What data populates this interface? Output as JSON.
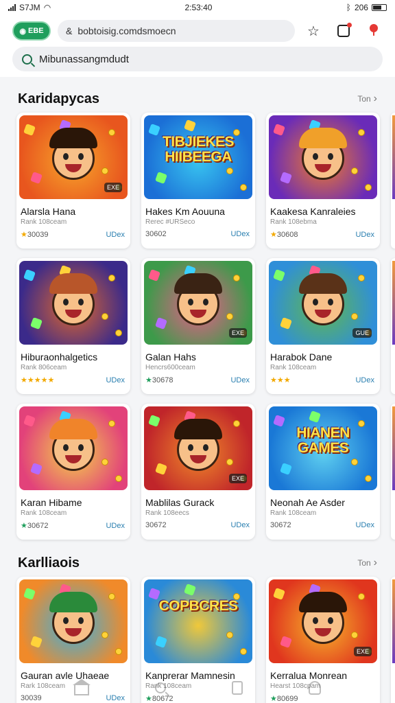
{
  "status_bar": {
    "carrier_time": "S7JM",
    "clock": "2:53:40",
    "battery": "206"
  },
  "browser": {
    "badge_label": "EBE",
    "url": "bobtoisig.comdsmoecn",
    "icons": [
      "star-icon",
      "tabs-icon",
      "notification-icon"
    ]
  },
  "search": {
    "value": "Mibunassangmdudt",
    "placeholder": "Mibunassangmdudt"
  },
  "sections": [
    {
      "title": "Karidapycas",
      "more": "Ton",
      "cards": [
        {
          "title": "Alarsla Hana",
          "sub": "Rank 108ceam",
          "rating": "30039",
          "star": "gold",
          "size": "UDex",
          "tag": "EXE",
          "bg": [
            "#e8561e",
            "#f7a52b"
          ],
          "hair": "#2a1608"
        },
        {
          "title": "Hakes Km Aouuna",
          "sub": "Rerec #URSeco",
          "rating": "30602",
          "star": "none",
          "size": "UDex",
          "banner": "TIBJIEKES HIIBEEGA",
          "bg": [
            "#1b6fd6",
            "#38c4f0"
          ],
          "hair": "#e66c1a"
        },
        {
          "title": "Kaakesa Kanraleies",
          "sub": "Rank 108ebma",
          "rating": "30608",
          "star": "gold",
          "size": "UDex",
          "bg": [
            "#6a2bb8",
            "#f07b2a"
          ],
          "hair": "#f0a02a"
        }
      ]
    },
    {
      "title": "",
      "more": "",
      "cards": [
        {
          "title": "Hiburaonhalgetics",
          "sub": "Rank 806ceam",
          "rating": "★★★★★",
          "star": "stars",
          "size": "UDex",
          "bg": [
            "#3b2a8a",
            "#e2682b"
          ],
          "hair": "#b8562a"
        },
        {
          "title": "Galan Hahs",
          "sub": "Hencrs600ceam",
          "rating": "30678",
          "star": "green",
          "size": "UDex",
          "tag": "EXE",
          "bg": [
            "#3d9a4a",
            "#e95d8a"
          ],
          "hair": "#3a2314"
        },
        {
          "title": "Harabok Dane",
          "sub": "Rank 108ceam",
          "rating": "★★★",
          "star": "stars",
          "size": "UDex",
          "tag": "GUE",
          "bg": [
            "#2f8fd8",
            "#62b84c"
          ],
          "hair": "#5a3218"
        }
      ]
    },
    {
      "title": "",
      "more": "",
      "cards": [
        {
          "title": "Karan Hibame",
          "sub": "Rank 108ceam",
          "rating": "30672",
          "star": "green",
          "size": "UDex",
          "bg": [
            "#e2427a",
            "#f4d14a"
          ],
          "hair": "#f0842a"
        },
        {
          "title": "Mablilas Gurack",
          "sub": "Rank 108eecs",
          "rating": "30672",
          "star": "none",
          "size": "UDex",
          "tag": "EXE",
          "bg": [
            "#c0252a",
            "#f08a2a"
          ],
          "hair": "#2a1608"
        },
        {
          "title": "Neonah Ae Asder",
          "sub": "Rank 108ceam",
          "rating": "30672",
          "star": "none",
          "size": "UDex",
          "banner": "HIANEN GAMES",
          "bg": [
            "#1a78d6",
            "#5fd0f0"
          ],
          "hair": "#f0a02a"
        }
      ]
    },
    {
      "title": "Karlliaois",
      "more": "Ton",
      "cards": [
        {
          "title": "Gauran avle Uhaeae",
          "sub": "Rark 108ceam",
          "rating": "30039",
          "star": "none",
          "size": "UDex",
          "bg": [
            "#f08a2a",
            "#3ab0e0"
          ],
          "hair": "#2a8a3a"
        },
        {
          "title": "Kanprerar Mamnesin",
          "sub": "Rank 108ceam",
          "rating": "80672",
          "star": "green",
          "size": "",
          "banner": "COPBCRES",
          "bg": [
            "#2a8ad8",
            "#f0c83a"
          ],
          "hair": "#3a2314"
        },
        {
          "title": "Kerralua Monrean",
          "sub": "Hearst 108cpam",
          "rating": "80699",
          "star": "green",
          "size": "",
          "tag": "EXE",
          "bg": [
            "#e0361e",
            "#f7b52b"
          ],
          "hair": "#2a1608"
        }
      ]
    }
  ],
  "bottom_nav": [
    "home-icon",
    "search-icon",
    "library-icon",
    "account-icon"
  ]
}
